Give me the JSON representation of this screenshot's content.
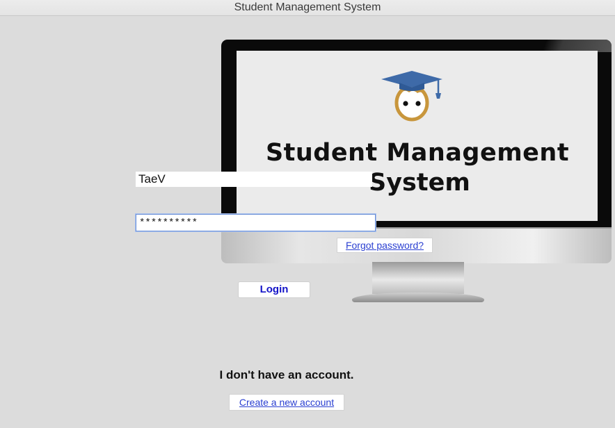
{
  "window": {
    "title": "Student Management System"
  },
  "banner": {
    "line1": "Student Management",
    "line2": "System"
  },
  "form": {
    "username_value": "TaeV",
    "password_value": "**********",
    "login_label": "Login",
    "forgot_label": "Forgot password?"
  },
  "signup": {
    "prompt": "I don't have an account.",
    "create_label": "Create a new account"
  },
  "colors": {
    "background": "#dcdcdc",
    "link": "#2a3fd1",
    "login_text": "#1414c8",
    "cap": "#3e6aa8",
    "face": "#c8963c"
  },
  "icons": {
    "logo": "student-graduate-icon"
  }
}
